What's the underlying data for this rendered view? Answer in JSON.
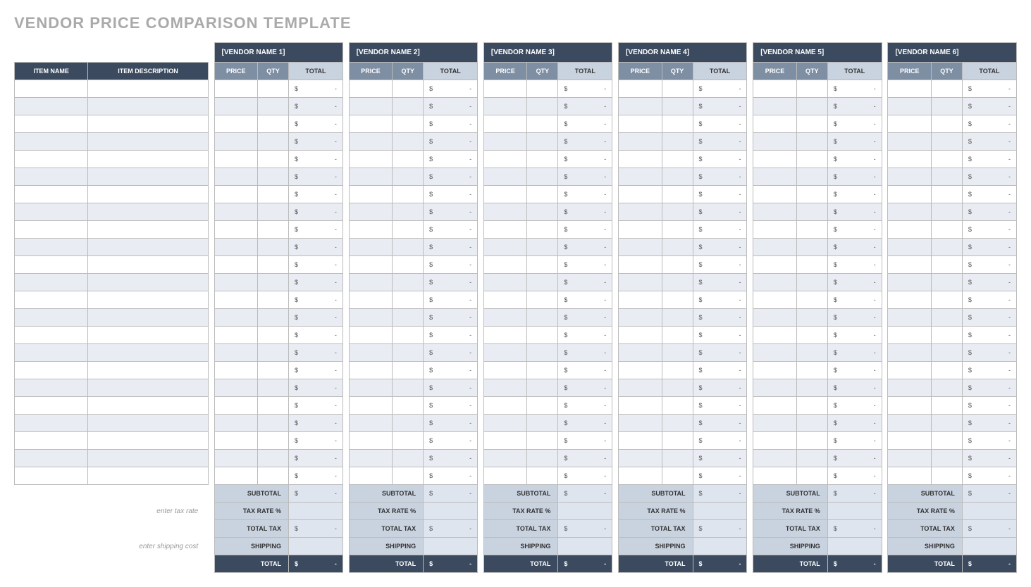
{
  "title": "VENDOR PRICE COMPARISON TEMPLATE",
  "headers": {
    "item_name": "ITEM NAME",
    "item_description": "ITEM DESCRIPTION",
    "price": "PRICE",
    "qty": "QTY",
    "total": "TOTAL"
  },
  "vendors": [
    {
      "name": "[VENDOR NAME 1]"
    },
    {
      "name": "[VENDOR NAME 2]"
    },
    {
      "name": "[VENDOR NAME 3]"
    },
    {
      "name": "[VENDOR NAME 4]"
    },
    {
      "name": "[VENDOR NAME 5]"
    },
    {
      "name": "[VENDOR NAME 6]"
    }
  ],
  "row_count": 23,
  "currency_symbol": "$",
  "empty_value": "-",
  "summary": {
    "subtotal_label": "SUBTOTAL",
    "tax_rate_label": "TAX RATE %",
    "tax_rate_hint": "enter tax rate",
    "total_tax_label": "TOTAL TAX",
    "shipping_label": "SHIPPING",
    "shipping_hint": "enter shipping cost",
    "total_label": "TOTAL"
  }
}
